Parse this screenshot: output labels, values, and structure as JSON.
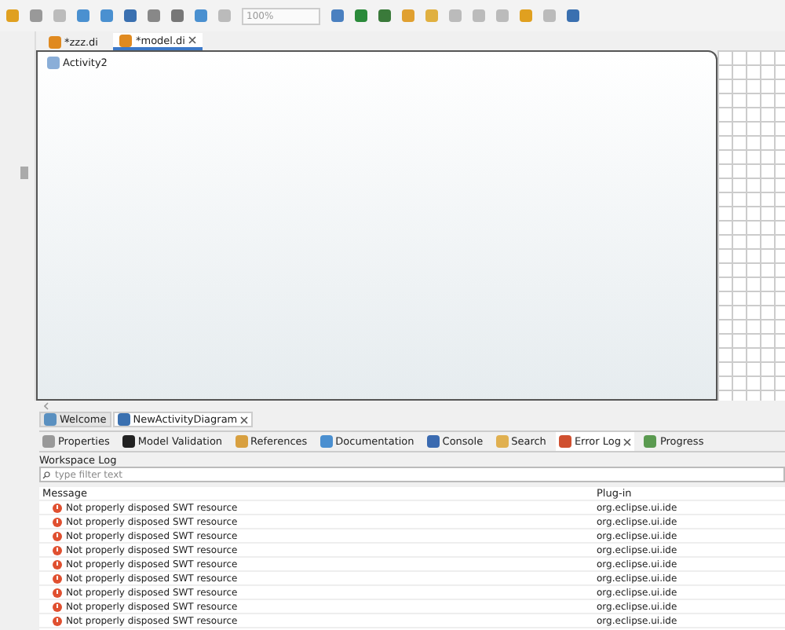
{
  "toolbar": {
    "zoom": "100%"
  },
  "editor_tabs": [
    {
      "label": "*zzz.di",
      "selected": false,
      "closable": false
    },
    {
      "label": "*model.di",
      "selected": true,
      "closable": true
    }
  ],
  "canvas": {
    "node": "Activity2"
  },
  "diagram_tabs": [
    {
      "label": "Welcome",
      "selected": false,
      "closable": false
    },
    {
      "label": "NewActivityDiagram",
      "selected": true,
      "closable": true
    }
  ],
  "view_tabs": [
    {
      "label": "Properties",
      "kind": "properties",
      "selected": false,
      "closable": false
    },
    {
      "label": "Model Validation",
      "kind": "validation",
      "selected": false,
      "closable": false
    },
    {
      "label": "References",
      "kind": "references",
      "selected": false,
      "closable": false
    },
    {
      "label": "Documentation",
      "kind": "documentation",
      "selected": false,
      "closable": false
    },
    {
      "label": "Console",
      "kind": "console",
      "selected": false,
      "closable": false
    },
    {
      "label": "Search",
      "kind": "search",
      "selected": false,
      "closable": false
    },
    {
      "label": "Error Log",
      "kind": "errorlog",
      "selected": true,
      "closable": true
    },
    {
      "label": "Progress",
      "kind": "progress",
      "selected": false,
      "closable": false
    }
  ],
  "log": {
    "title": "Workspace Log",
    "filter": {
      "placeholder": "type filter text"
    },
    "columns": [
      "Message",
      "Plug-in"
    ],
    "rows": [
      {
        "message": "Not properly disposed SWT resource",
        "plugin": "org.eclipse.ui.ide"
      },
      {
        "message": "Not properly disposed SWT resource",
        "plugin": "org.eclipse.ui.ide"
      },
      {
        "message": "Not properly disposed SWT resource",
        "plugin": "org.eclipse.ui.ide"
      },
      {
        "message": "Not properly disposed SWT resource",
        "plugin": "org.eclipse.ui.ide"
      },
      {
        "message": "Not properly disposed SWT resource",
        "plugin": "org.eclipse.ui.ide"
      },
      {
        "message": "Not properly disposed SWT resource",
        "plugin": "org.eclipse.ui.ide"
      },
      {
        "message": "Not properly disposed SWT resource",
        "plugin": "org.eclipse.ui.ide"
      },
      {
        "message": "Not properly disposed SWT resource",
        "plugin": "org.eclipse.ui.ide"
      },
      {
        "message": "Not properly disposed SWT resource",
        "plugin": "org.eclipse.ui.ide"
      }
    ]
  }
}
